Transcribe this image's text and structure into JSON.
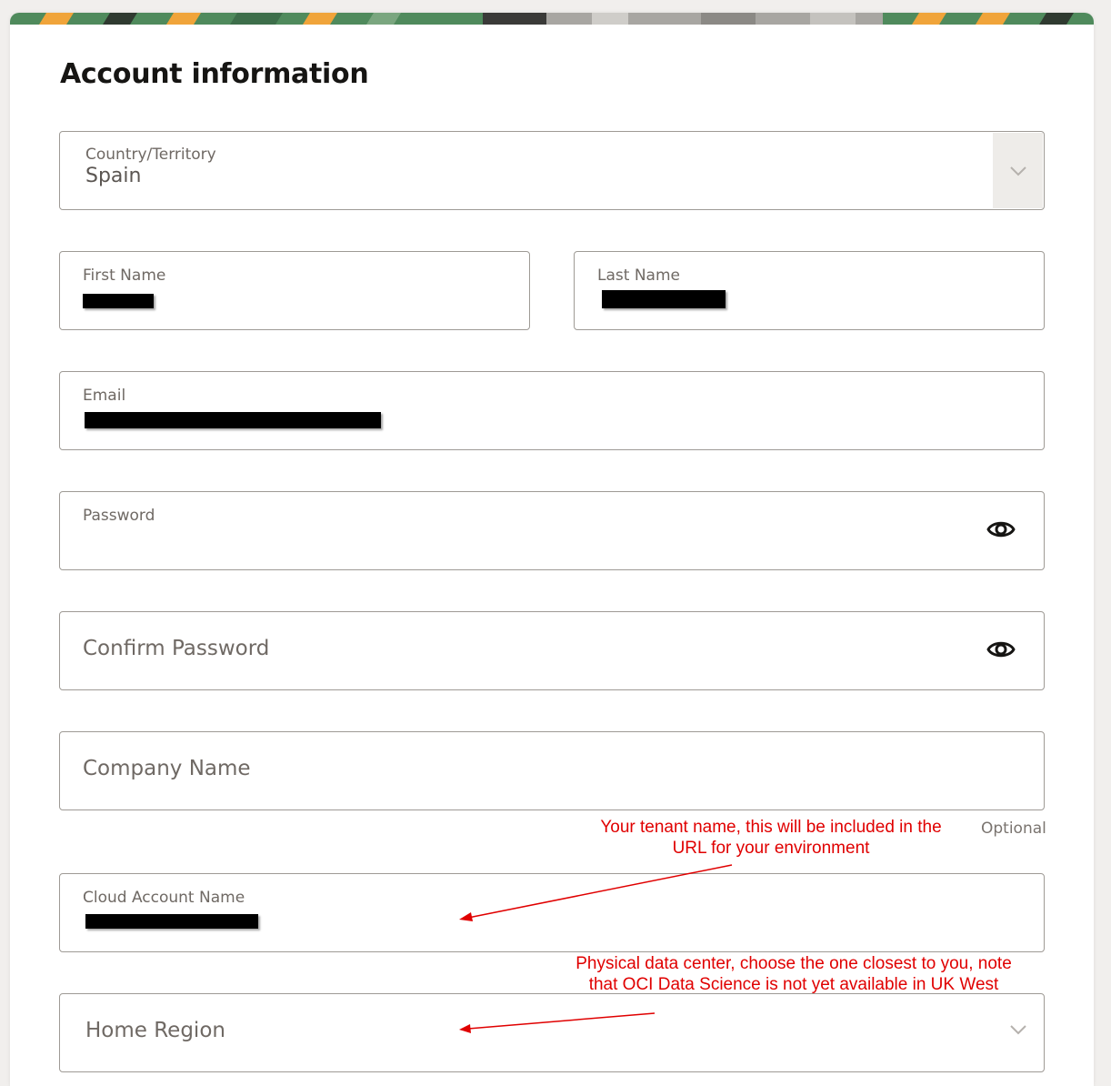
{
  "form": {
    "title": "Account information",
    "country": {
      "label": "Country/Territory",
      "value": "Spain"
    },
    "first_name": {
      "label": "First Name"
    },
    "last_name": {
      "label": "Last Name"
    },
    "email": {
      "label": "Email"
    },
    "password": {
      "label": "Password"
    },
    "confirm_password": {
      "placeholder": "Confirm Password"
    },
    "company_name": {
      "placeholder": "Company Name",
      "hint": "Optional"
    },
    "cloud_account": {
      "label": "Cloud Account Name"
    },
    "home_region": {
      "placeholder": "Home Region"
    }
  },
  "annotations": {
    "tenant_note": "Your tenant name, this will be included in the URL for your environment",
    "region_note": "Physical data center, choose the one closest to you, note that OCI Data Science is not yet available in UK West and UAE East (Dubai)."
  },
  "icons": {
    "select_chevron": "chevron-down-icon",
    "password_toggle": "eye-icon"
  },
  "colors": {
    "annotation_red": "#e00000",
    "field_border": "#9e9a95",
    "banner_green": "#4f8a5c",
    "banner_orange": "#f0a43a"
  }
}
